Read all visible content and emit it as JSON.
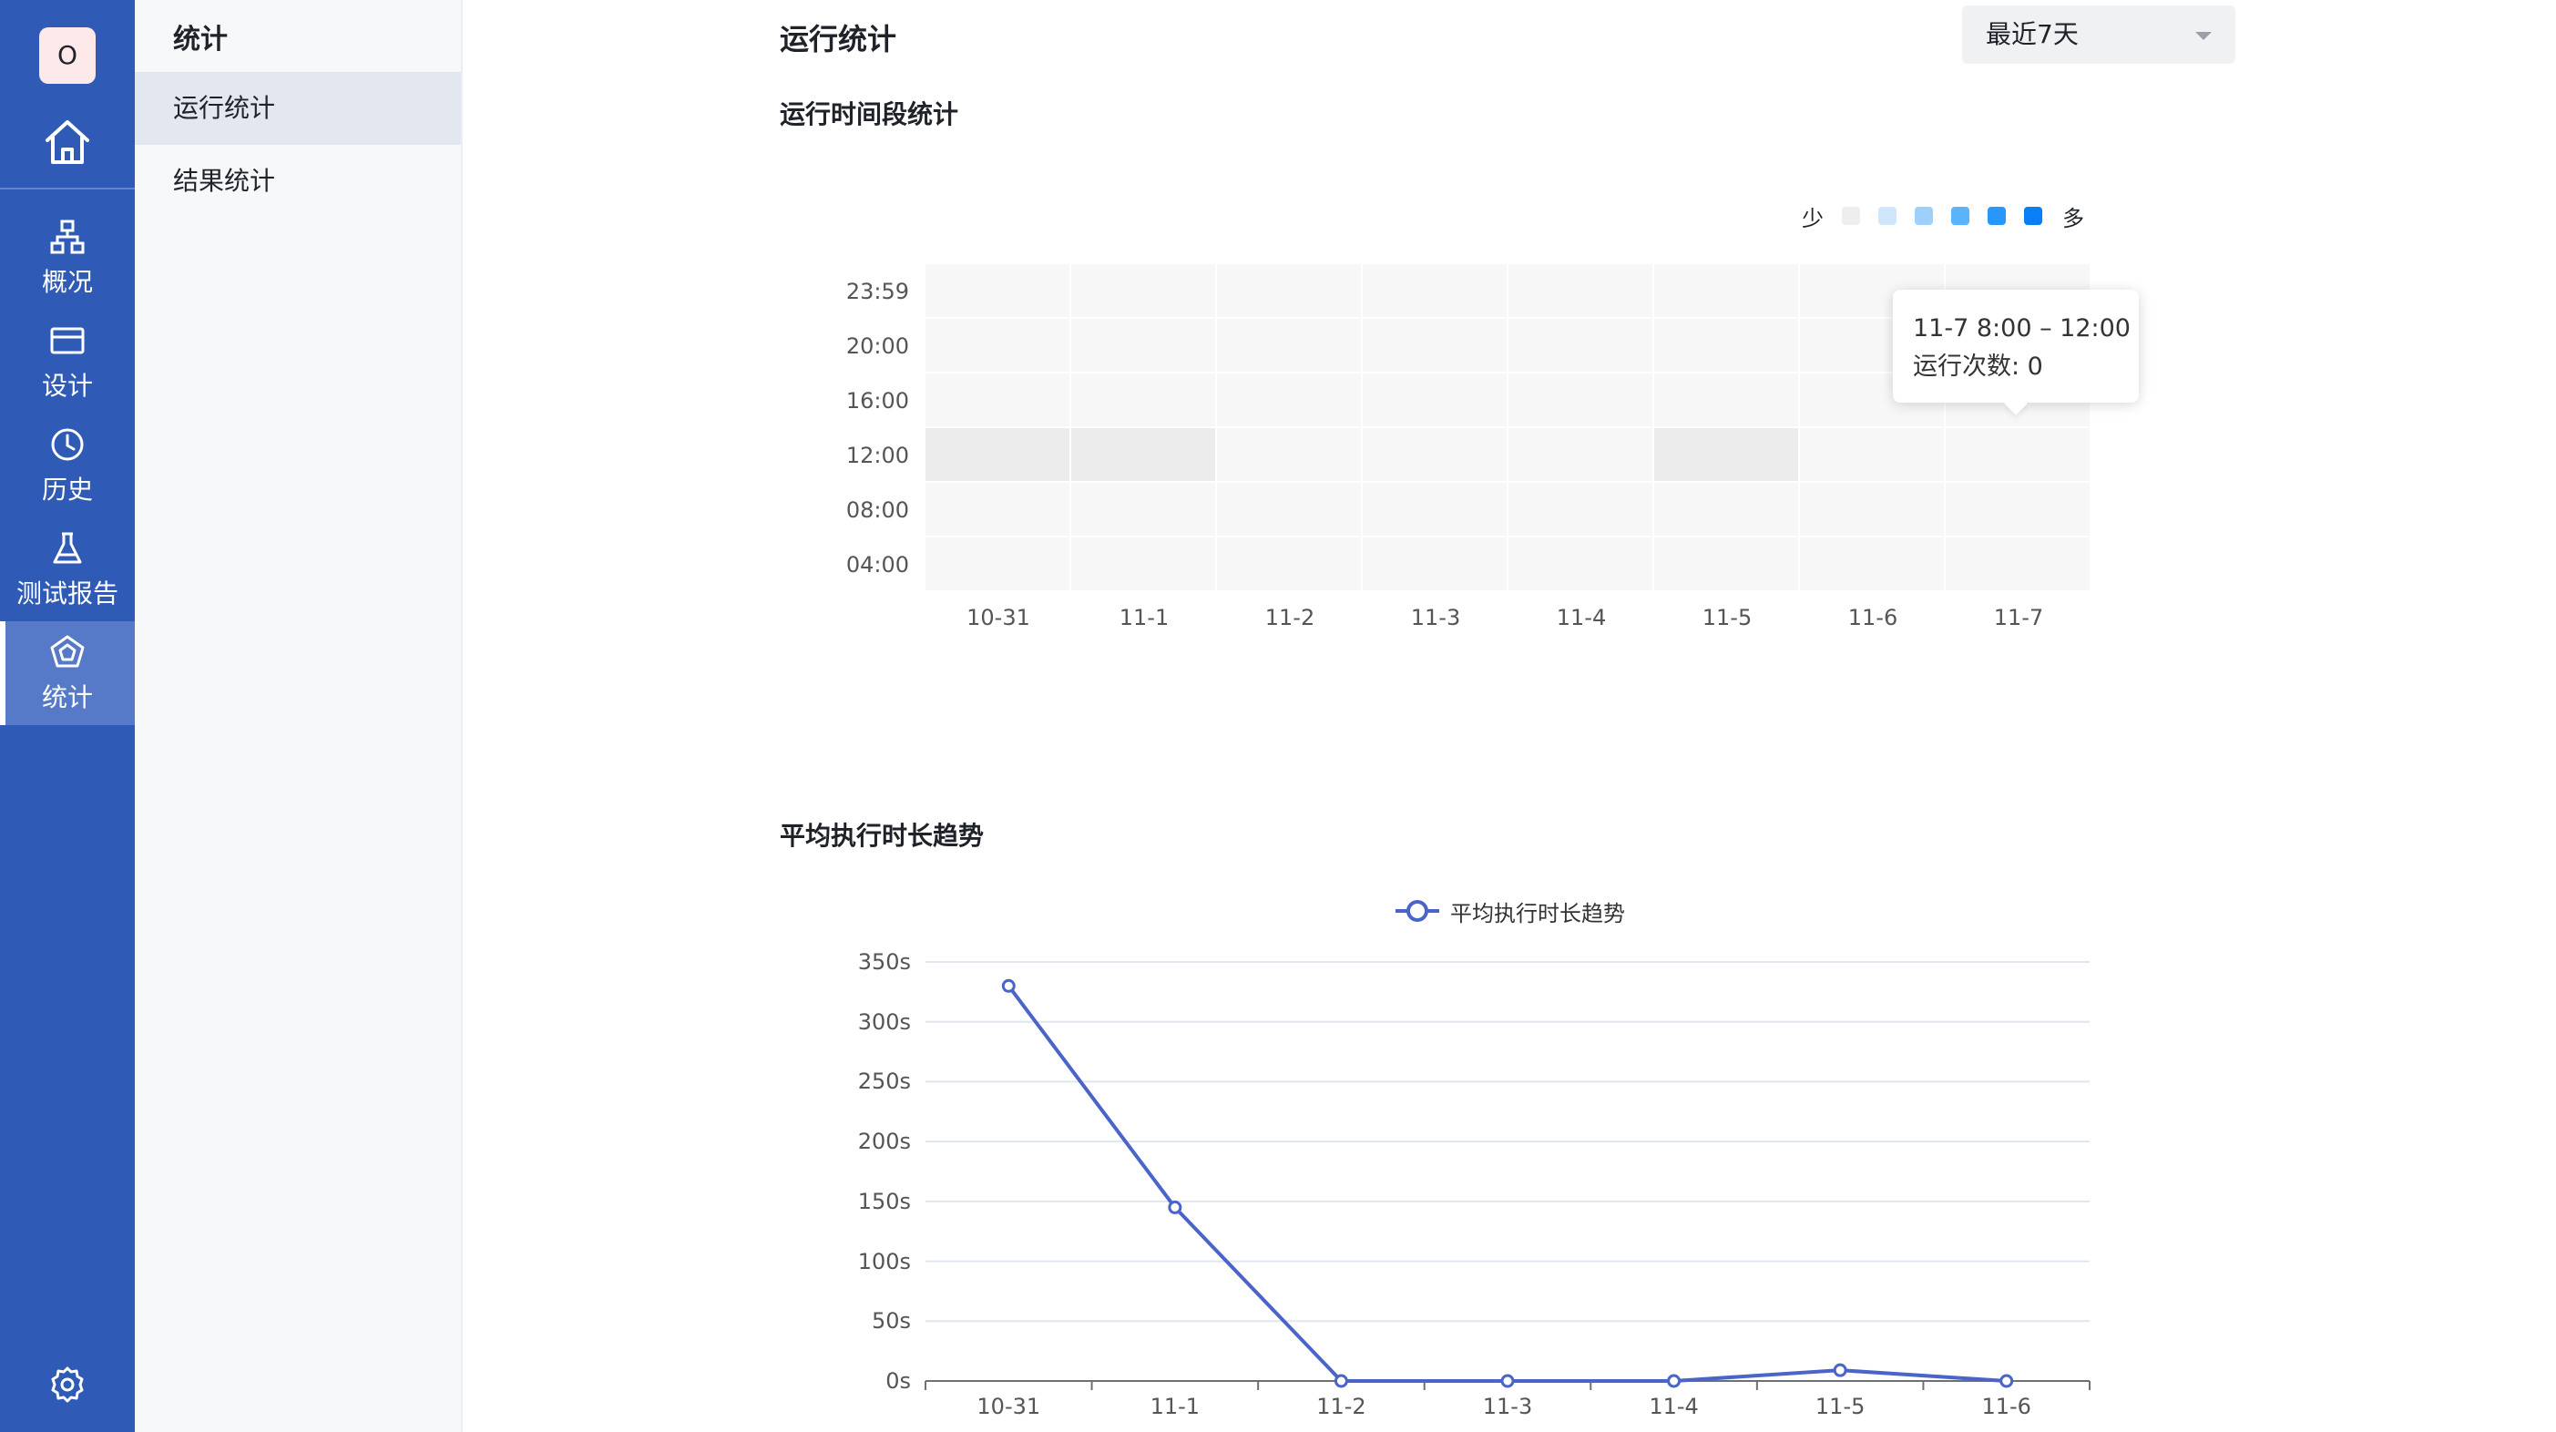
{
  "rail": {
    "avatar": "O",
    "items": [
      {
        "label": "概况",
        "icon": "sitemap-icon"
      },
      {
        "label": "设计",
        "icon": "card-icon"
      },
      {
        "label": "历史",
        "icon": "clock-icon"
      },
      {
        "label": "测试报告",
        "icon": "flask-icon"
      },
      {
        "label": "统计",
        "icon": "pentagon-icon"
      }
    ]
  },
  "subnav": {
    "title": "统计",
    "items": [
      "运行统计",
      "结果统计"
    ]
  },
  "main": {
    "title": "运行统计",
    "range_select": "最近7天",
    "heatmap_title": "运行时间段统计",
    "trend_title": "平均执行时长趋势"
  },
  "chart_data": [
    {
      "type": "heatmap",
      "x": [
        "10-31",
        "11-1",
        "11-2",
        "11-3",
        "11-4",
        "11-5",
        "11-6",
        "11-7"
      ],
      "y": [
        "23:59",
        "20:00",
        "16:00",
        "12:00",
        "08:00",
        "04:00"
      ],
      "active_cells": [
        {
          "x": "10-31",
          "y": "12:00"
        },
        {
          "x": "11-1",
          "y": "12:00"
        },
        {
          "x": "11-5",
          "y": "12:00"
        }
      ],
      "legend": {
        "low": "少",
        "high": "多",
        "colors": [
          "#eeeeee",
          "#cfe6fb",
          "#9dd0fb",
          "#5ab4fb",
          "#2797fb",
          "#0a7ef5"
        ]
      },
      "tooltip": {
        "line1": "11-7 8:00 – 12:00",
        "line2": "运行次数: 0"
      }
    },
    {
      "type": "line",
      "title": "",
      "legend": "平均执行时长趋势",
      "categories": [
        "10-31",
        "11-1",
        "11-2",
        "11-3",
        "11-4",
        "11-5",
        "11-6"
      ],
      "series": [
        {
          "name": "平均执行时长趋势",
          "values": [
            330,
            145,
            0,
            0,
            0,
            9,
            0
          ]
        }
      ],
      "ylim": [
        0,
        350
      ],
      "yticks": [
        "0s",
        "50s",
        "100s",
        "150s",
        "200s",
        "250s",
        "300s",
        "350s"
      ],
      "color": "#4a64c8",
      "grid": true
    }
  ]
}
